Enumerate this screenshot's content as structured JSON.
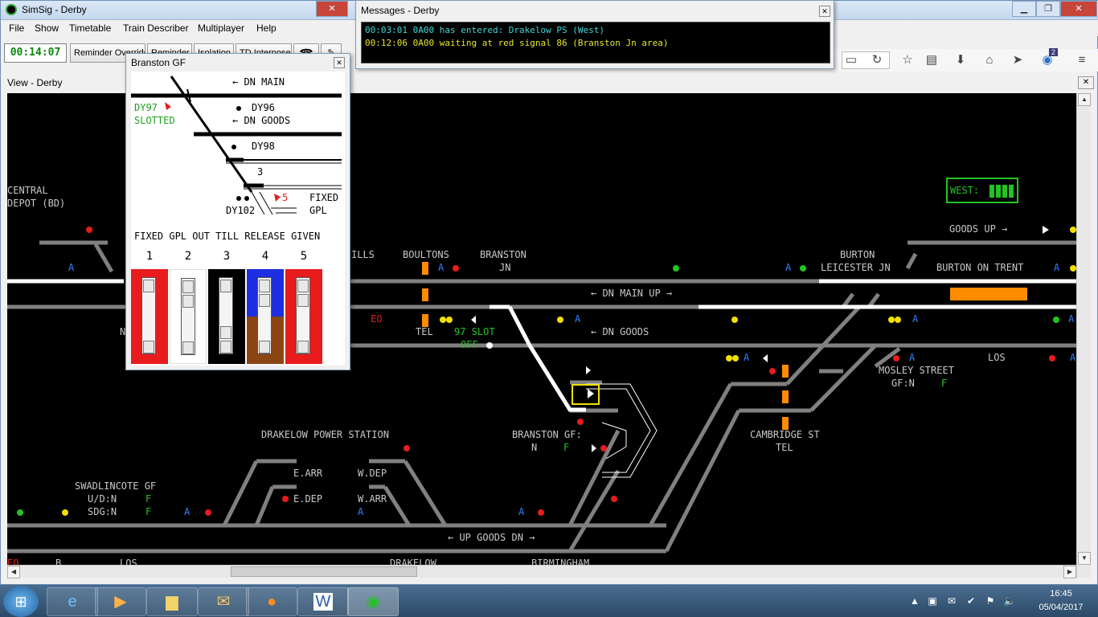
{
  "app": {
    "title": "SimSig - Derby"
  },
  "menu": [
    "File",
    "Show",
    "Timetable",
    "Train Describer",
    "Multiplayer",
    "Help"
  ],
  "toolbar": {
    "clock": "00:14:07",
    "buttons": [
      "Reminder Override",
      "Reminder",
      "Isolation",
      "TD Interpose"
    ]
  },
  "messages": {
    "title": "Messages - Derby",
    "lines": [
      {
        "text": "00:03:01 0A00 has entered: Drakelow PS (West)",
        "color": "#3fd7d7"
      },
      {
        "text": "00:12:06 0A00 waiting at red signal 86 (Branston Jn area)",
        "color": "#e6e62e"
      }
    ]
  },
  "view": {
    "title": "View - Derby"
  },
  "panel": {
    "title": "Branston GF",
    "labels": {
      "dn_main": "← DN MAIN",
      "dy97": "DY97",
      "slotted": "SLOTTED",
      "dy96": "DY96",
      "dn_goods": "← DN GOODS",
      "dy98": "DY98",
      "three": "3",
      "five": "5",
      "fixed": "FIXED",
      "dy102": "DY102",
      "gpl": "GPL",
      "notice": "FIXED GPL OUT TILL RELEASE GIVEN"
    },
    "levers": [
      {
        "num": "1",
        "color": "#e81c1c",
        "pulled": false
      },
      {
        "num": "2",
        "color": "#ffffff",
        "pulled": true
      },
      {
        "num": "3",
        "color": "#000000",
        "pulled": false
      },
      {
        "num": "4",
        "color": "#1e2ee0",
        "lower_color": "#8b4513",
        "pulled": false
      },
      {
        "num": "5",
        "color": "#e81c1c",
        "pulled": false
      }
    ]
  },
  "diagram": {
    "labels": {
      "central": "CENTRAL",
      "depot": "DEPOT (BD)",
      "boultons": "BOULTONS",
      "branston": "BRANSTON",
      "jn": "JN",
      "ills": "ILLS",
      "tel": "TEL",
      "slot97": "97 SLOT",
      "off": "OFF",
      "dn_main_up": "← DN MAIN UP →",
      "dn_goods": "← DN GOODS",
      "burton": "BURTON",
      "leicester_jn": "LEICESTER JN",
      "burton_on_trent": "BURTON ON TRENT",
      "goods_up": "GOODS UP →",
      "west": "WEST:",
      "mosley": "MOSLEY STREET",
      "mosley_gf": "GF:N",
      "los": "LOS",
      "cambridge": "CAMBRIDGE ST",
      "cambridge_tel": "TEL",
      "branston_gf": "BRANSTON GF:",
      "branston_gf_state": "N",
      "drakelow": "DRAKELOW POWER STATION",
      "e_arr": "E.ARR",
      "e_dep": "E.DEP",
      "w_dep": "W.DEP",
      "w_arr": "W.ARR",
      "swadlincote": "SWADLINCOTE GF",
      "ud": "U/D:N",
      "sdg": "SDG:N",
      "f": "F",
      "up_goods_dn": "← UP GOODS DN →",
      "drakelow_bottom": "DRAKELOW",
      "birmingham": "BIRMINGHAM",
      "n_left": "N",
      "eo": "EO",
      "a": "A",
      "los_left": "LOS",
      "b": "B"
    }
  },
  "taskbar": {
    "time": "16:45",
    "date": "05/04/2017"
  },
  "colors": {
    "track": "#808080",
    "route": "#ffffff",
    "label": "#c8c8c8",
    "green": "#22c322",
    "red": "#e81c1c",
    "yellow": "#f0e000",
    "blue": "#3080ff",
    "orange": "#ff8c00"
  }
}
